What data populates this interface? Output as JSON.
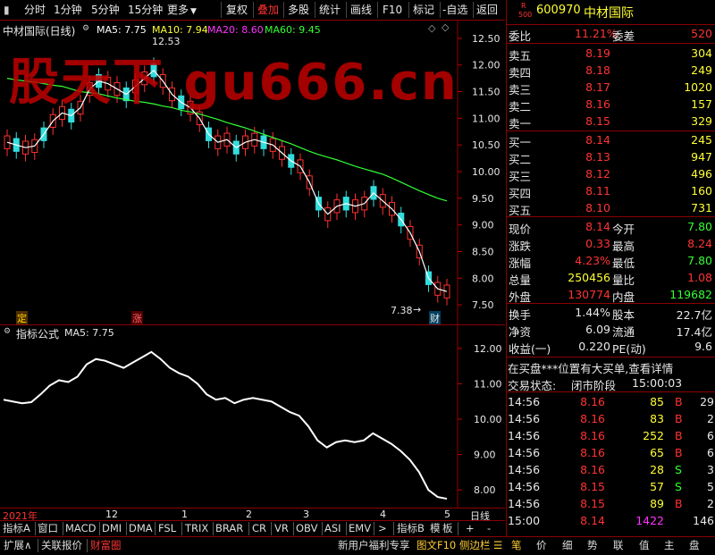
{
  "toolbar": {
    "left_items": [
      "分时",
      "1分钟",
      "5分钟",
      "15分钟",
      "更多"
    ],
    "right_items": [
      "复权",
      "叠加",
      "多股",
      "统计",
      "画线",
      "F10",
      "标记",
      "-自选",
      "返回"
    ],
    "active": "叠加"
  },
  "main_chart": {
    "title": "中材国际(日线)",
    "ma_legend": [
      {
        "label": "MA5: 7.75",
        "color": "#ffffff"
      },
      {
        "label": "MA10: 7.94",
        "color": "#ffff00"
      },
      {
        "label": "MA20: 8.60",
        "color": "#ff33ff"
      },
      {
        "label": "MA60: 9.45",
        "color": "#33ff33"
      }
    ],
    "y_ticks": [
      "12.50",
      "12.00",
      "11.50",
      "11.00",
      "10.50",
      "10.00",
      "9.50",
      "9.00",
      "8.50",
      "8.00",
      "7.50"
    ],
    "high_marker": "12.53",
    "low_marker": "7.38",
    "tags": [
      "定",
      "涨",
      "财"
    ],
    "watermark": "股天下 gu666.cn"
  },
  "sub_chart": {
    "title": "指标公式",
    "legend": "MA5: 7.75",
    "y_ticks": [
      "12.00",
      "11.00",
      "10.00",
      "9.00",
      "8.00"
    ]
  },
  "chart_data": {
    "type": "line",
    "title": "中材国际(日线)",
    "series": [
      {
        "name": "MA5",
        "values": [
          10.55,
          10.5,
          10.45,
          10.48,
          10.7,
          10.95,
          11.1,
          11.05,
          11.2,
          11.55,
          11.7,
          11.65,
          11.55,
          11.45,
          11.6,
          11.75,
          11.9,
          11.7,
          11.45,
          11.3,
          11.2,
          11.0,
          10.7,
          10.55,
          10.6,
          10.45,
          10.55,
          10.6,
          10.55,
          10.5,
          10.35,
          10.2,
          10.1,
          9.8,
          9.4,
          9.2,
          9.35,
          9.4,
          9.35,
          9.4,
          9.6,
          9.45,
          9.3,
          9.1,
          8.85,
          8.5,
          8.0,
          7.8,
          7.75
        ]
      },
      {
        "name": "MA60",
        "values": [
          11.75,
          11.72,
          11.7,
          11.68,
          11.65,
          11.62,
          11.6,
          11.55,
          11.5,
          11.48,
          11.46,
          11.42,
          11.38,
          11.35,
          11.32,
          11.3,
          11.27,
          11.23,
          11.2,
          11.15,
          11.12,
          11.08,
          11.03,
          10.98,
          10.92,
          10.87,
          10.82,
          10.76,
          10.7,
          10.64,
          10.58,
          10.52,
          10.45,
          10.38,
          10.32,
          10.27,
          10.22,
          10.16,
          10.1,
          10.05,
          10.0,
          9.95,
          9.88,
          9.8,
          9.72,
          9.64,
          9.57,
          9.5,
          9.45
        ]
      }
    ],
    "ylim": [
      7.3,
      12.7
    ],
    "high": 12.53,
    "low": 7.38,
    "x_ticks": [
      "2021年",
      "12",
      "1",
      "2",
      "3",
      "4",
      "5"
    ],
    "x_right_label": "日线"
  },
  "bottom_tabs": {
    "row1": [
      "指标A",
      "窗口",
      "MACD",
      "DMI",
      "DMA",
      "FSL",
      "TRIX",
      "BRAR",
      "CR",
      "VR",
      "OBV",
      "ASI",
      "EMV",
      ">",
      "指标B",
      "模",
      "板",
      "+",
      "-"
    ],
    "row2_left": [
      "扩展∧",
      "关联报价",
      "财富圈"
    ],
    "row2_mid": [
      "新用户福利专享",
      "图文F10",
      "侧边栏"
    ],
    "row2_right": [
      "笔",
      "价",
      "细",
      "势",
      "联",
      "值",
      "主",
      "盘"
    ]
  },
  "quote": {
    "code": "600970",
    "name": "中材国际",
    "badge_r": "R",
    "badge_num": "500",
    "weibi_label": "委比",
    "weibi": "11.21%",
    "weicha_label": "委差",
    "weicha": "520",
    "sells": [
      {
        "label": "卖五",
        "price": "8.19",
        "vol": "304"
      },
      {
        "label": "卖四",
        "price": "8.18",
        "vol": "249"
      },
      {
        "label": "卖三",
        "price": "8.17",
        "vol": "1020"
      },
      {
        "label": "卖二",
        "price": "8.16",
        "vol": "157"
      },
      {
        "label": "卖一",
        "price": "8.15",
        "vol": "329"
      }
    ],
    "buys": [
      {
        "label": "买一",
        "price": "8.14",
        "vol": "245"
      },
      {
        "label": "买二",
        "price": "8.13",
        "vol": "947"
      },
      {
        "label": "买三",
        "price": "8.12",
        "vol": "496"
      },
      {
        "label": "买四",
        "price": "8.11",
        "vol": "160"
      },
      {
        "label": "买五",
        "price": "8.10",
        "vol": "731"
      }
    ],
    "stats": [
      {
        "l1": "现价",
        "v1": "8.14",
        "c1": "red",
        "l2": "今开",
        "v2": "7.80",
        "c2": "green"
      },
      {
        "l1": "涨跌",
        "v1": "0.33",
        "c1": "red",
        "l2": "最高",
        "v2": "8.24",
        "c2": "red"
      },
      {
        "l1": "涨幅",
        "v1": "4.23%",
        "c1": "red",
        "l2": "最低",
        "v2": "7.80",
        "c2": "green"
      },
      {
        "l1": "总量",
        "v1": "250456",
        "c1": "yellow",
        "l2": "量比",
        "v2": "1.08",
        "c2": "red"
      },
      {
        "l1": "外盘",
        "v1": "130774",
        "c1": "red",
        "l2": "内盘",
        "v2": "119682",
        "c2": "green"
      }
    ],
    "finance": [
      {
        "l1": "换手",
        "v1": "1.44%",
        "l2": "股本",
        "v2": "22.7亿"
      },
      {
        "l1": "净资",
        "v1": "6.09",
        "l2": "流通",
        "v2": "17.4亿"
      },
      {
        "l1": "收益(一)",
        "v1": "0.220",
        "l2": "PE(动)",
        "v2": "9.6"
      }
    ],
    "notice": "在买盘***位置有大买单,查看详情",
    "status_label": "交易状态:",
    "status": "闭市阶段",
    "status_time": "15:00:03",
    "ticks": [
      {
        "time": "14:56",
        "price": "8.16",
        "vol": "85",
        "side": "B",
        "num": "29"
      },
      {
        "time": "14:56",
        "price": "8.16",
        "vol": "83",
        "side": "B",
        "num": "2"
      },
      {
        "time": "14:56",
        "price": "8.16",
        "vol": "252",
        "side": "B",
        "num": "6"
      },
      {
        "time": "14:56",
        "price": "8.16",
        "vol": "65",
        "side": "B",
        "num": "6"
      },
      {
        "time": "14:56",
        "price": "8.16",
        "vol": "28",
        "side": "S",
        "num": "3"
      },
      {
        "time": "14:56",
        "price": "8.15",
        "vol": "57",
        "side": "S",
        "num": "5"
      },
      {
        "time": "14:56",
        "price": "8.15",
        "vol": "89",
        "side": "B",
        "num": "2"
      },
      {
        "time": "15:00",
        "price": "8.14",
        "vol": "1422",
        "side": "",
        "num": "146"
      }
    ]
  }
}
